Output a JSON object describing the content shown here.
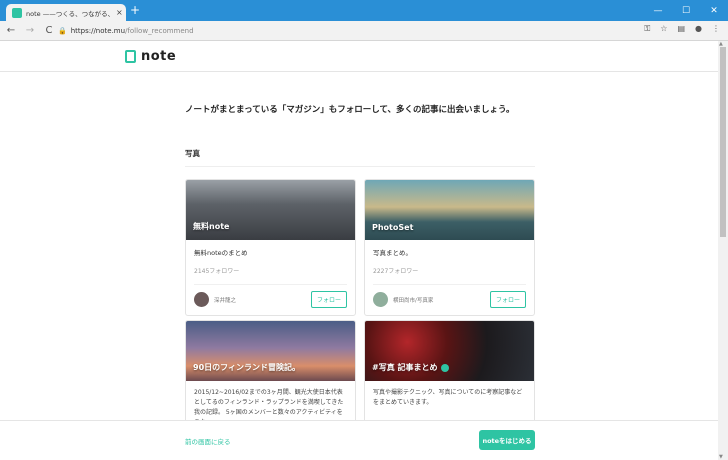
{
  "browser": {
    "tab_title": "note ——つくる、つながる、とどける。",
    "url_host": "https://note.mu",
    "url_path": "/follow_recommend",
    "new_tab": "+",
    "close": "×",
    "back": "←",
    "forward": "→",
    "reload": "C"
  },
  "site": {
    "logo_text": "note"
  },
  "intro": "ノートがまとまっている「マガジン」もフォローして、多くの記事に出会いましょう。",
  "section_title": "写真",
  "cards": [
    {
      "image_label": "無料note",
      "title": "無料noteのまとめ",
      "count": "2145フォロワー",
      "owner": "深井龍之",
      "follow": "フォロー"
    },
    {
      "image_label": "PhotoSet",
      "title": "写真まとめ。",
      "count": "2227フォロワー",
      "owner": "横田尚市/写真家",
      "follow": "フォロー"
    },
    {
      "image_label": "90日のフィンランド冒険記。",
      "desc": "2015/12~2016/02までの3ヶ月間、観光大使日本代表としてるのフィンランド・ラップランドを満喫してきた我の記録。 5ヶ国のメンバーと数々のアクティビティをこな"
    },
    {
      "image_label": "#写真 記事まとめ",
      "desc": "写真や撮影テクニック、写真についてのに考察記事などをまとめていきます。"
    }
  ],
  "bottom": {
    "back_label": "前の画面に戻る",
    "start_label": "noteをはじめる"
  }
}
